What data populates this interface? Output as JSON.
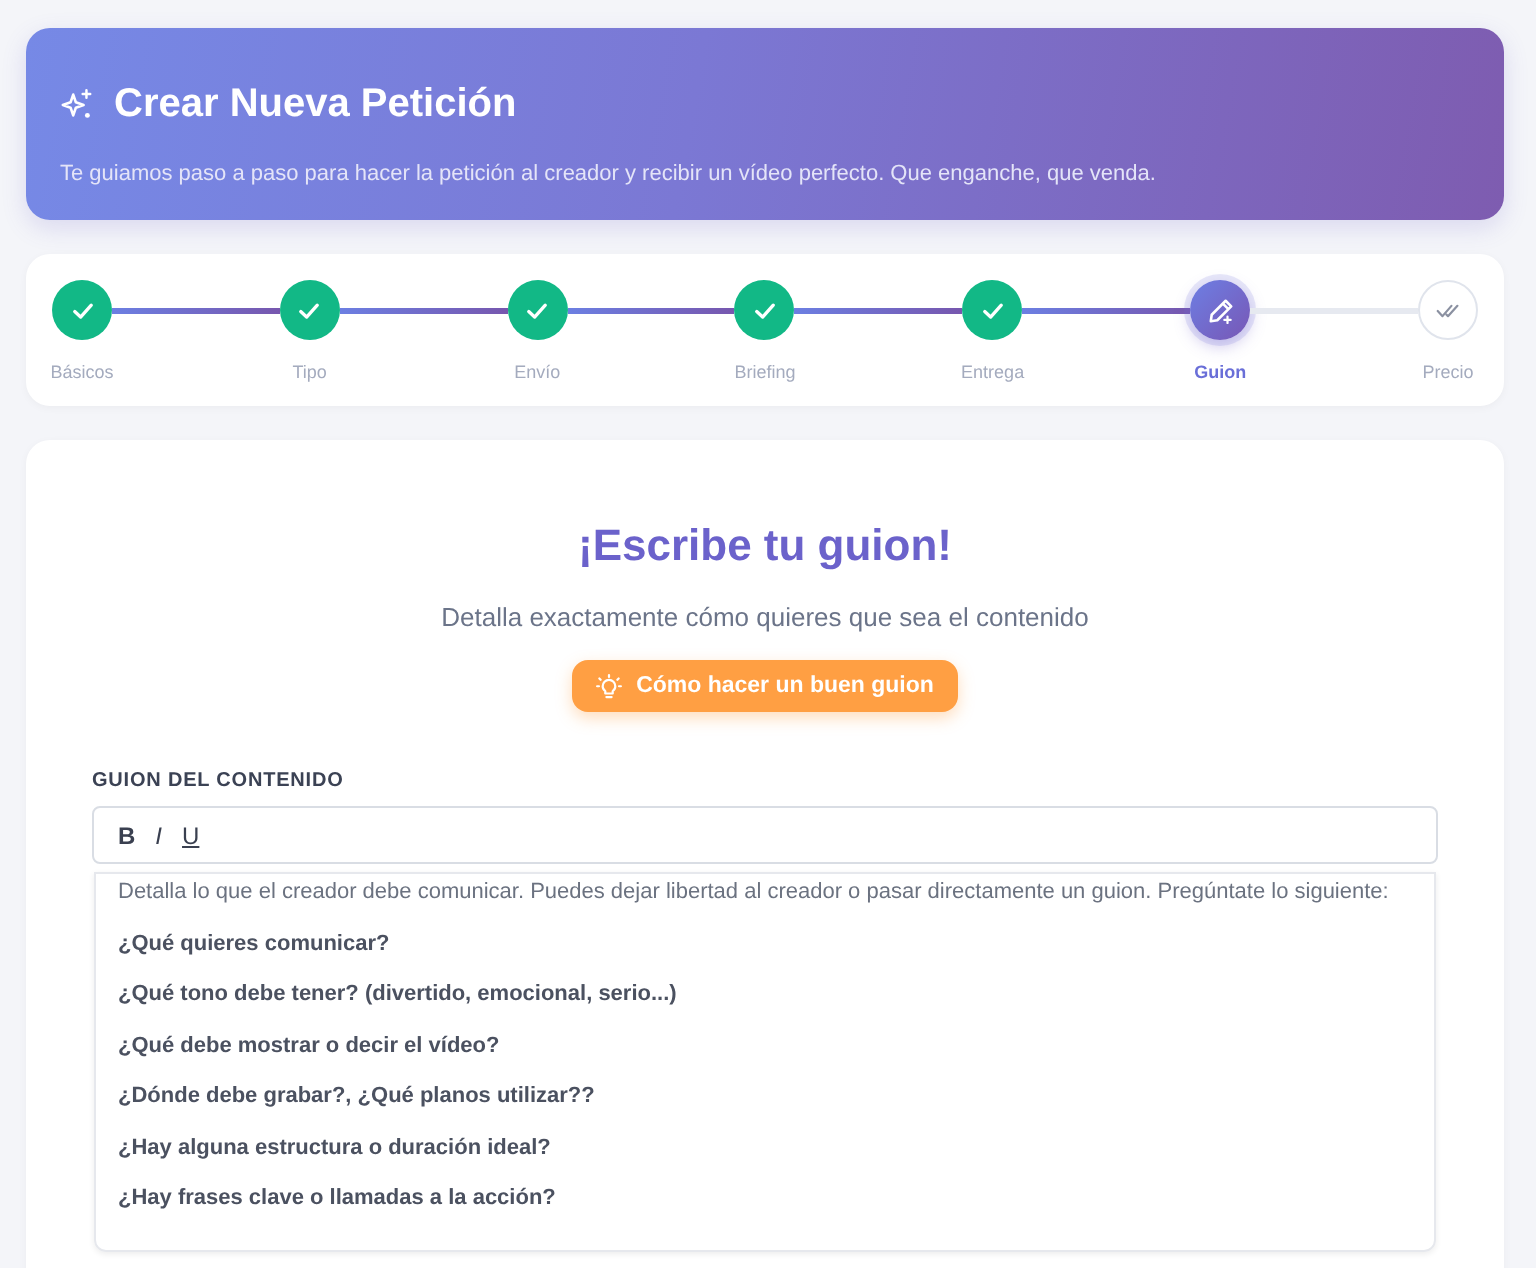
{
  "header": {
    "title": "Crear Nueva Petición",
    "subtitle": "Te guiamos paso a paso para hacer la petición al creador y recibir un vídeo perfecto. Que enganche, que venda."
  },
  "steps": [
    {
      "label": "Básicos",
      "completed": true,
      "selected": false
    },
    {
      "label": "Tipo",
      "completed": true,
      "selected": false
    },
    {
      "label": "Envío",
      "completed": true,
      "selected": false
    },
    {
      "label": "Briefing",
      "completed": true,
      "selected": false
    },
    {
      "label": "Entrega",
      "completed": true,
      "selected": false
    },
    {
      "label": "Guion",
      "completed": false,
      "selected": true
    },
    {
      "label": "Precio",
      "completed": false,
      "selected": false
    }
  ],
  "main": {
    "title": "¡Escribe tu guion!",
    "subtitle": "Detalla exactamente cómo quieres que sea el contenido",
    "help_button": "Cómo hacer un buen guion"
  },
  "script_field": {
    "label": "GUION DEL CONTENIDO",
    "toolbar": [
      {
        "kind": "bold",
        "label": "B"
      },
      {
        "kind": "italic",
        "label": "I"
      },
      {
        "kind": "underline",
        "label": "U"
      }
    ],
    "paragraphs": [
      {
        "text": "Detalla lo que el creador debe comunicar. Puedes dejar libertad al creador o pasar directamente un guion. Pregúntate lo siguiente:",
        "bold": false
      },
      {
        "text": "¿Qué quieres comunicar?",
        "bold": true
      },
      {
        "text": "¿Qué tono debe tener? (divertido, emocional, serio...)",
        "bold": true
      },
      {
        "text": "¿Qué debe mostrar o decir el vídeo?",
        "bold": true
      },
      {
        "text": "¿Dónde debe grabar?, ¿Qué planos utilizar??",
        "bold": true
      },
      {
        "text": "¿Hay alguna estructura o duración ideal?",
        "bold": true
      },
      {
        "text": "¿Hay frases clave o llamadas a la acción?",
        "bold": true
      }
    ]
  }
}
